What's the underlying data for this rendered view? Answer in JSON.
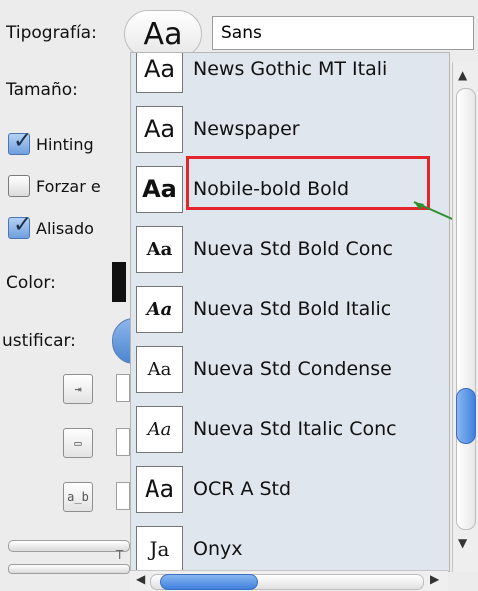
{
  "left_panel": {
    "typography_label": "Tipografía:",
    "size_label": "Tamaño:",
    "color_label": "Color:",
    "justify_label": "ustificar:"
  },
  "preview": {
    "sample": "Aa"
  },
  "font_input": {
    "value": "Sans"
  },
  "checkboxes": [
    {
      "label": "Hinting",
      "checked": true
    },
    {
      "label": "Forzar e",
      "checked": false
    },
    {
      "label": "Alisado",
      "checked": true
    }
  ],
  "font_list": [
    {
      "sample": "Aa",
      "name": "News Gothic MT Itali"
    },
    {
      "sample": "Aa",
      "name": "Newspaper"
    },
    {
      "sample": "Aa",
      "name": "Nobile-bold Bold",
      "highlighted": true
    },
    {
      "sample": "Aa",
      "name": "Nueva Std Bold Conc"
    },
    {
      "sample": "Aa",
      "name": "Nueva Std Bold Italic"
    },
    {
      "sample": "Aa",
      "name": "Nueva Std Condense"
    },
    {
      "sample": "Aa",
      "name": "Nueva Std Italic Conc"
    },
    {
      "sample": "Aa",
      "name": "OCR A Std"
    },
    {
      "sample": "Ja",
      "name": "Onyx"
    }
  ],
  "icons": {
    "indent": "indent-icon",
    "box": "box-icon",
    "letter_spacing": "letter-spacing-icon",
    "arrow_up": "arrow-up-icon",
    "arrow_down": "arrow-down-icon",
    "arrow_left": "arrow-left-icon",
    "arrow_right": "arrow-right-icon"
  },
  "slider": {
    "marker": "T"
  }
}
